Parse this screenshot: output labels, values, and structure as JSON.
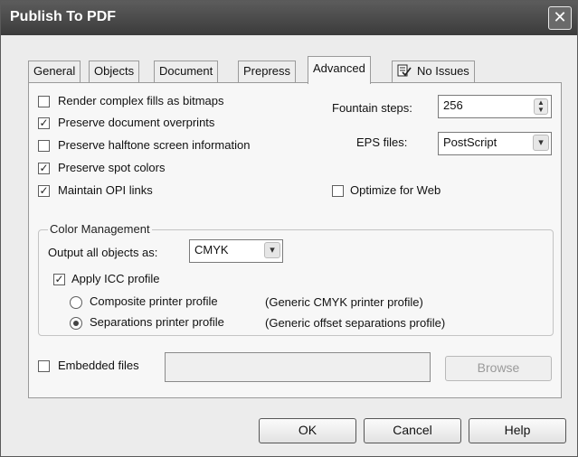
{
  "window": {
    "title": "Publish To PDF",
    "close_symbol": "✕"
  },
  "tabs": [
    {
      "label": "General"
    },
    {
      "label": "Objects"
    },
    {
      "label": "Document"
    },
    {
      "label": "Prepress"
    },
    {
      "label": "Advanced"
    },
    {
      "label": "No Issues",
      "icon": "issues-icon"
    }
  ],
  "active_tab": "Advanced",
  "advanced": {
    "options": [
      {
        "label": "Render complex fills as bitmaps",
        "checked": false
      },
      {
        "label": "Preserve document overprints",
        "checked": true
      },
      {
        "label": "Preserve halftone screen information",
        "checked": false
      },
      {
        "label": "Preserve spot colors",
        "checked": true
      },
      {
        "label": "Maintain OPI links",
        "checked": true
      }
    ],
    "fountain_steps": {
      "label": "Fountain steps:",
      "value": "256"
    },
    "eps_files": {
      "label": "EPS files:",
      "value": "PostScript"
    },
    "optimize_web": {
      "label": "Optimize for Web",
      "checked": false
    }
  },
  "color_management": {
    "title": "Color Management",
    "output_label": "Output all objects as:",
    "output_value": "CMYK",
    "apply_icc": {
      "label": "Apply ICC profile",
      "checked": true
    },
    "composite": {
      "label": "Composite printer profile",
      "profile": "(Generic CMYK printer profile)",
      "selected": false
    },
    "separations": {
      "label": "Separations printer profile",
      "profile": "(Generic offset separations profile)",
      "selected": true
    }
  },
  "embedded": {
    "label": "Embedded files",
    "checked": false,
    "value": "",
    "browse_label": "Browse"
  },
  "buttons": {
    "ok": "OK",
    "cancel": "Cancel",
    "help": "Help"
  },
  "glyphs": {
    "check": "✓",
    "spin_up": "▲",
    "spin_down": "▼",
    "dropdown": "▾"
  }
}
